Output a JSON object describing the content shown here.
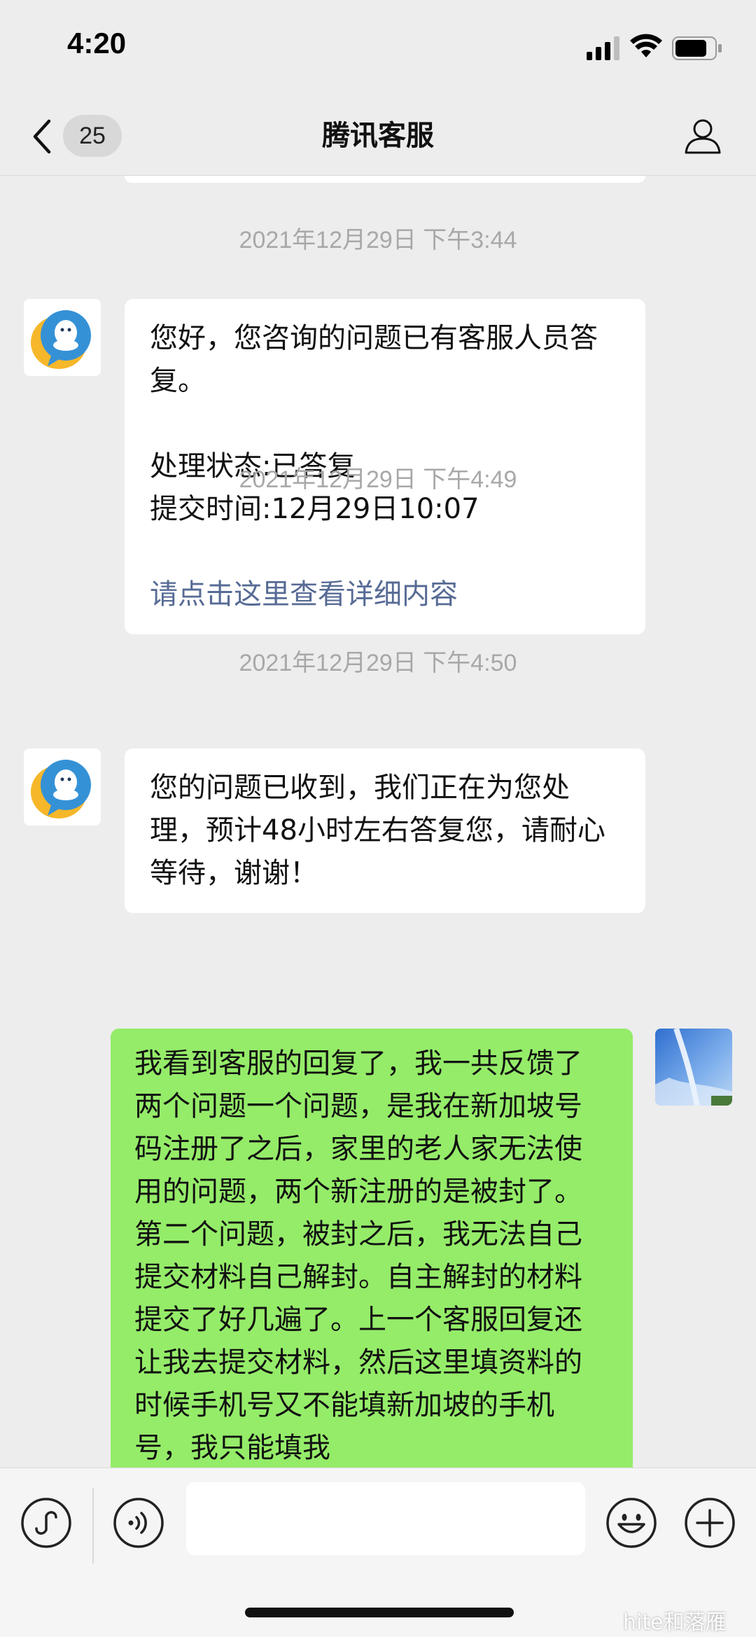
{
  "status_bar": {
    "time": "4:20"
  },
  "nav": {
    "unread_count": "25",
    "title": "腾讯客服"
  },
  "messages": [
    {
      "timestamp": "2021年12月29日 下午3:44",
      "lines": [
        "您好，您咨询的问题已有客服人员答复。"
      ],
      "status": "处理状态:已答复",
      "submit_time": "提交时间:12月29日10:07",
      "link": "请点击这里查看详细内容"
    },
    {
      "timestamp": "2021年12月29日 下午4:49",
      "text": "您的问题已收到，我们正在为您处理，预计48小时左右答复您，请耐心等待，谢谢！"
    },
    {
      "timestamp": "2021年12月29日 下午4:50",
      "text": "我看到客服的回复了，我一共反馈了两个问题一个问题，是我在新加坡号码注册了之后，家里的老人家无法使用的问题，两个新注册的是被封了。第二个问题，被封之后，我无法自己提交材料自己解封。自主解封的材料提交了好几遍了。上一个客服回复还让我去提交材料，然后这里填资料的时候手机号又不能填新加坡的手机号，我只能填我"
    }
  ],
  "input": {
    "value": ""
  },
  "watermark": "hite和落雁",
  "colors": {
    "background": "#ededed",
    "outgoing_bubble": "#95ec69",
    "incoming_bubble": "#ffffff",
    "link": "#576b95",
    "timestamp": "#a8a8a8"
  },
  "icons": [
    "back-icon",
    "profile-icon",
    "mini-program-icon",
    "voice-icon",
    "emoji-icon",
    "plus-icon",
    "qq-support-avatar",
    "sky-avatar"
  ]
}
